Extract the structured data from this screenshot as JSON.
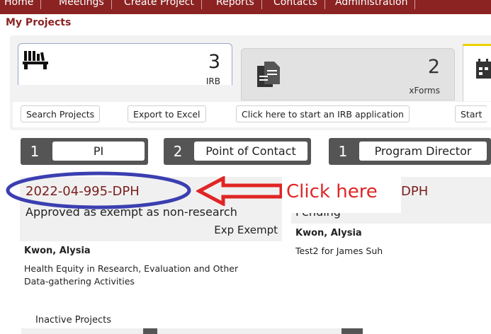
{
  "nav": {
    "items": [
      "Home",
      "Meetings",
      "Create Project",
      "Reports",
      "Contacts",
      "Administration"
    ]
  },
  "breadcrumb": "My Projects",
  "stats": [
    {
      "count": "3",
      "label": "IRB",
      "icon": "books-icon"
    },
    {
      "count": "2",
      "label": "xForms",
      "icon": "documents-icon"
    }
  ],
  "actions": {
    "search": "Search Projects",
    "export": "Export to Excel",
    "start_irb": "Click here to start an IRB application",
    "start_other": "Start"
  },
  "roles": [
    {
      "count": "1",
      "label": "PI"
    },
    {
      "count": "2",
      "label": "Point of Contact"
    },
    {
      "count": "1",
      "label": "Program Director"
    }
  ],
  "projects": [
    {
      "id": "2022-04-995-DPH",
      "status": "Approved as exempt as non-research",
      "type": "Exp Exempt",
      "pi": "Kwon, Alysia",
      "description": "Health Equity in Research, Evaluation and Other Data-gathering Activities"
    },
    {
      "id_tail": "DPH",
      "status": "Pending",
      "pi": "Kwon, Alysia",
      "description": "Test2 for James Suh"
    }
  ],
  "annotation": {
    "text": "Click here",
    "color": "#e02525",
    "oval_color": "#3b3fb0"
  },
  "inactive_label": "Inactive Projects",
  "colors": {
    "nav": "#8b2323",
    "accent": "#7a1f1f",
    "role_dark": "#555555"
  }
}
